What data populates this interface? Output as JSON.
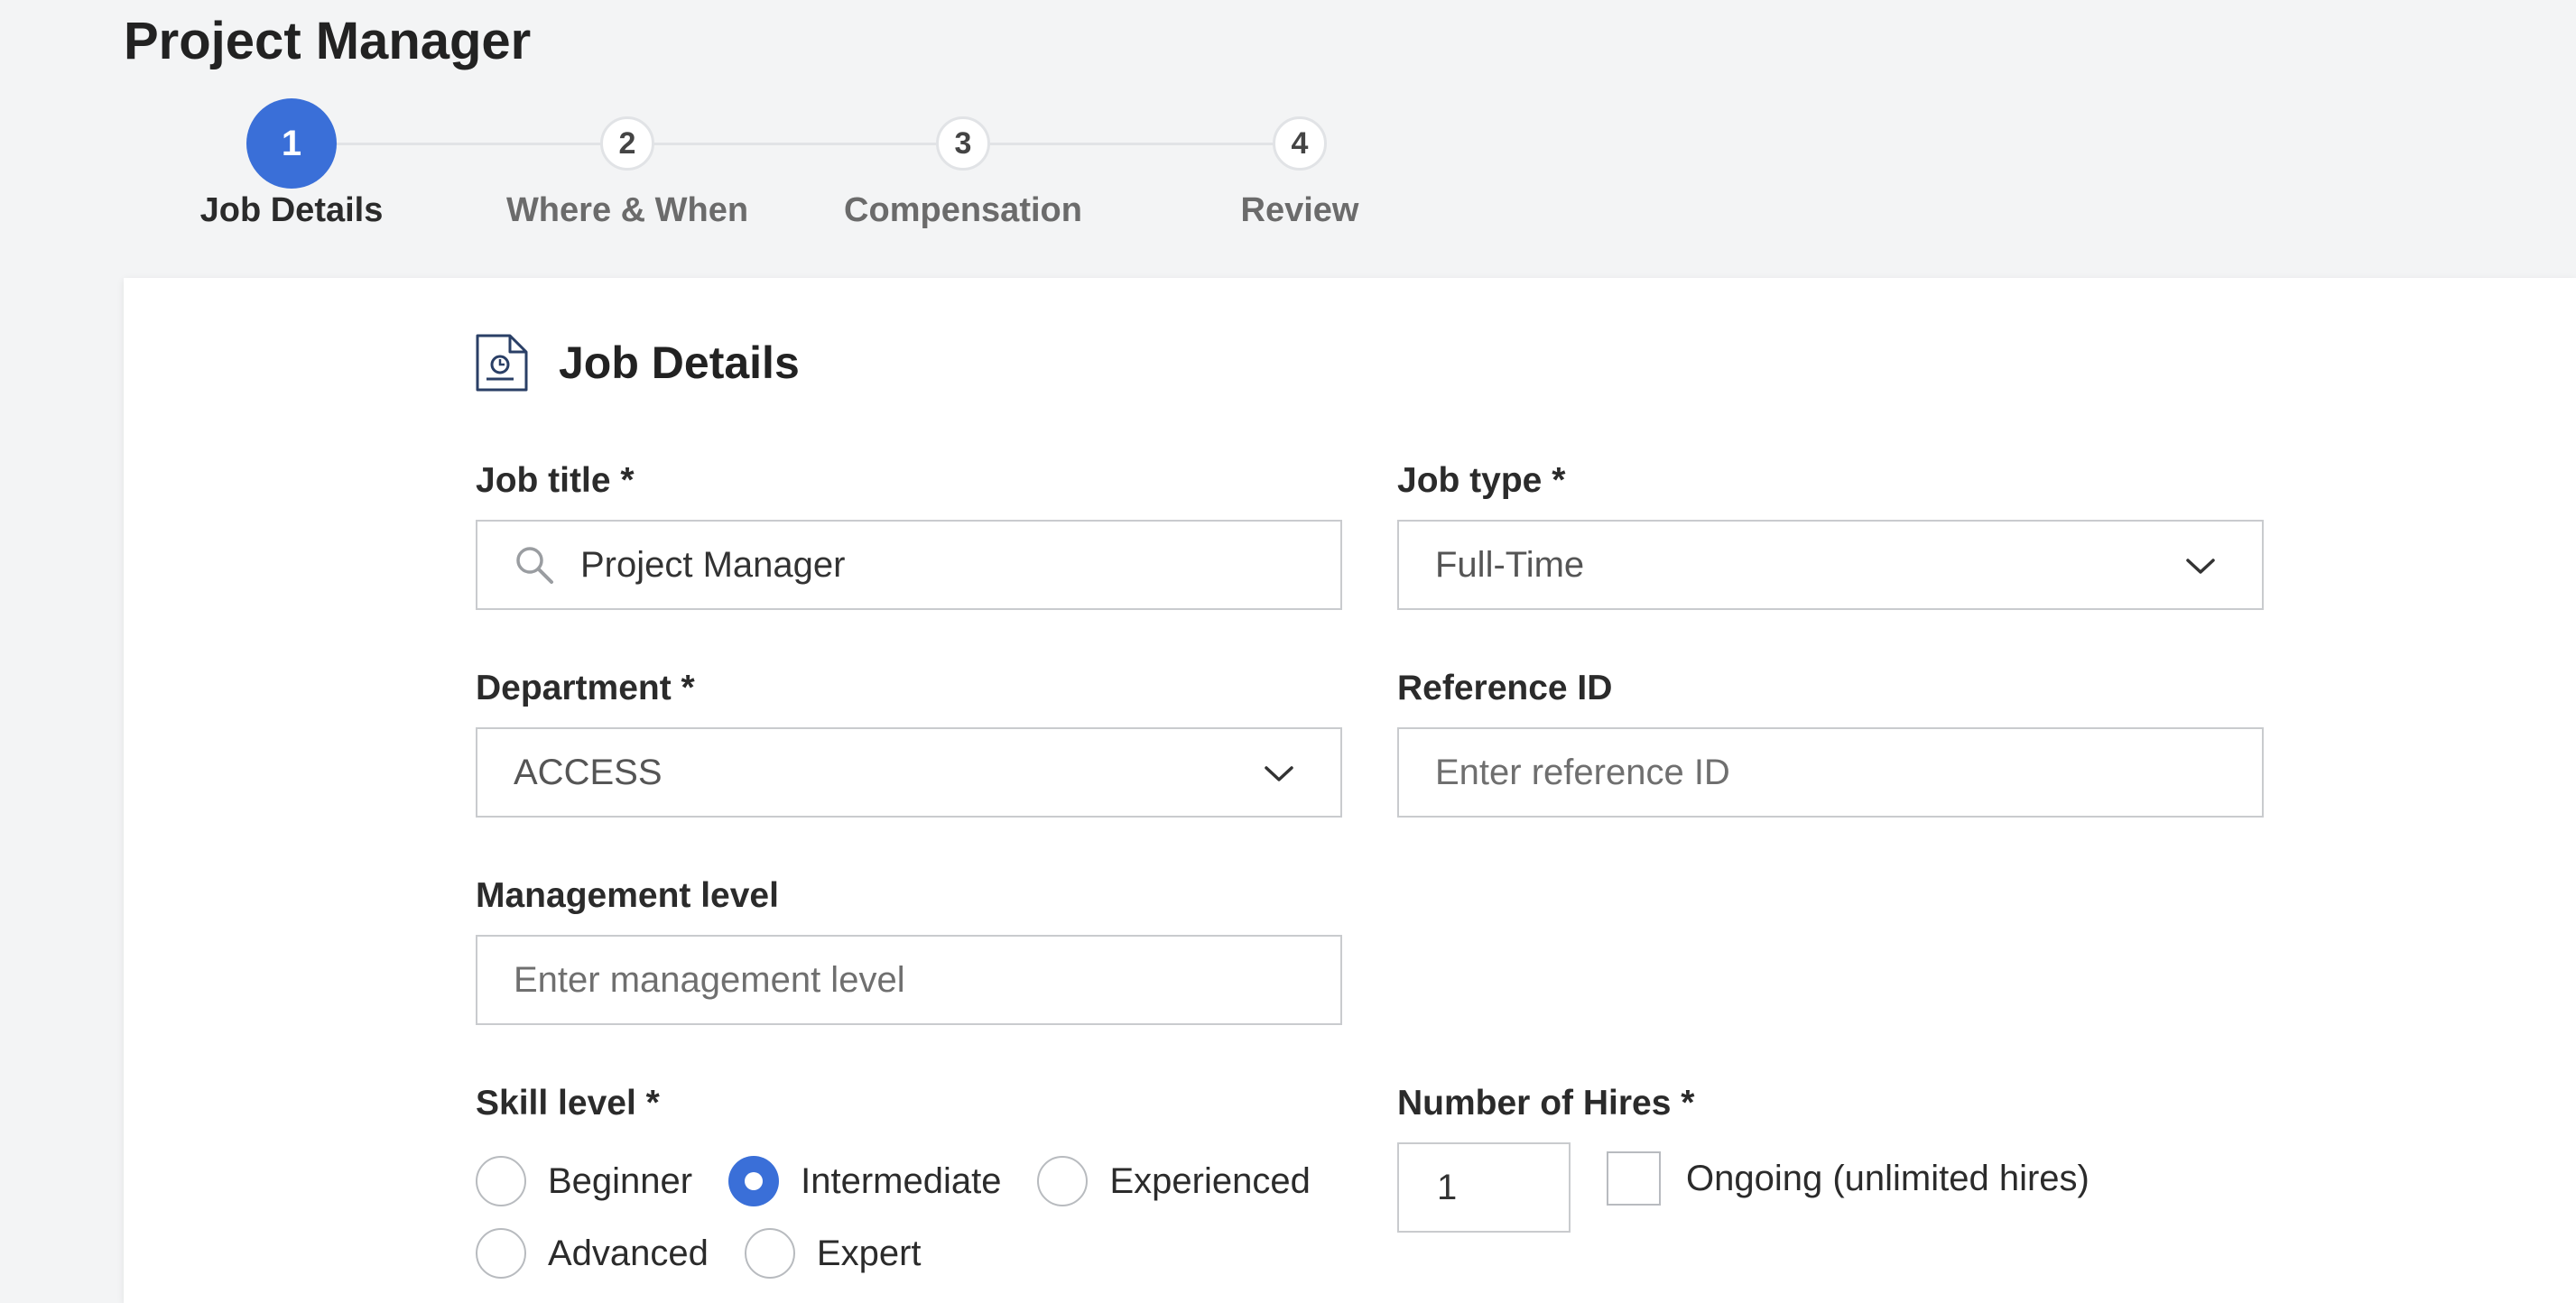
{
  "header": {
    "title": "Project Manager"
  },
  "stepper": {
    "steps": [
      {
        "number": "1",
        "label": "Job Details",
        "active": true
      },
      {
        "number": "2",
        "label": "Where & When",
        "active": false
      },
      {
        "number": "3",
        "label": "Compensation",
        "active": false
      },
      {
        "number": "4",
        "label": "Review",
        "active": false
      }
    ]
  },
  "section": {
    "title": "Job Details",
    "icon": "document-clock-icon"
  },
  "form": {
    "job_title": {
      "label": "Job title *",
      "value": "Project Manager",
      "icon": "search-icon"
    },
    "job_type": {
      "label": "Job type *",
      "value": "Full-Time"
    },
    "department": {
      "label": "Department *",
      "value": "ACCESS"
    },
    "reference_id": {
      "label": "Reference ID",
      "placeholder": "Enter reference ID"
    },
    "management_level": {
      "label": "Management level",
      "placeholder": "Enter management level"
    },
    "skill_level": {
      "label": "Skill level *",
      "options": [
        "Beginner",
        "Intermediate",
        "Experienced",
        "Advanced",
        "Expert"
      ],
      "selected": "Intermediate"
    },
    "number_of_hires": {
      "label": "Number of Hires *",
      "value": "1",
      "ongoing_label": "Ongoing (unlimited hires)",
      "ongoing_checked": false
    }
  },
  "colors": {
    "accent": "#3a6fd8",
    "border": "#c9cbce",
    "background": "#f3f4f5"
  }
}
